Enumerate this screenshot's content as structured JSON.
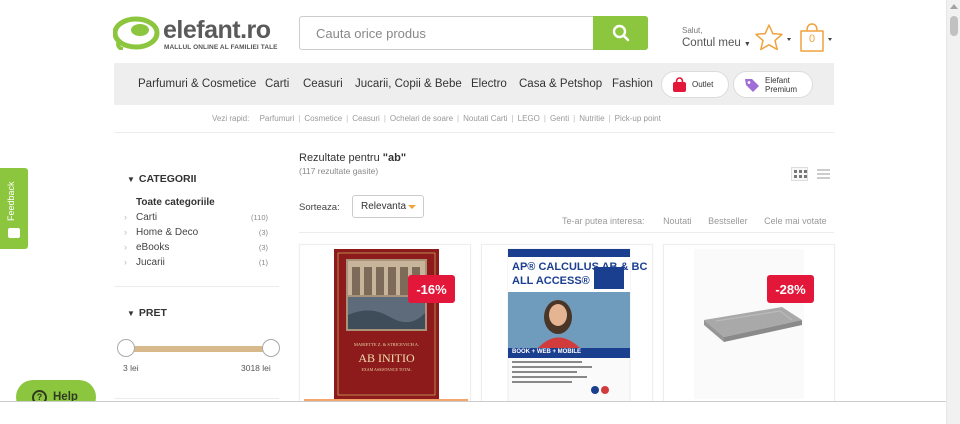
{
  "header": {
    "logo_text": "elefant.ro",
    "logo_tagline": "MALLUL ONLINE AL FAMILIEI TALE",
    "search_placeholder": "Cauta orice produs",
    "greeting": "Salut,",
    "account_label": "Contul meu",
    "cart_count": "0"
  },
  "nav": {
    "items": [
      "Parfumuri & Cosmetice",
      "Carti",
      "Ceasuri",
      "Jucarii, Copii & Bebe",
      "Electro",
      "Casa & Petshop",
      "Fashion"
    ],
    "outlet_label": "Outlet",
    "premium_label_1": "Elefant",
    "premium_label_2": "Premium"
  },
  "quick_links": {
    "label": "Vezi rapid:",
    "items": [
      "Parfumuri",
      "Cosmetice",
      "Ceasuri",
      "Ochelari de soare",
      "Noutati Carti",
      "LEGO",
      "Genti",
      "Nutritie",
      "Pick-up point"
    ]
  },
  "sidebar": {
    "categories_title": "CATEGORII",
    "all_categories": "Toate categoriile",
    "categories": [
      {
        "name": "Carti",
        "count": "(110)"
      },
      {
        "name": "Home & Deco",
        "count": "(3)"
      },
      {
        "name": "eBooks",
        "count": "(3)"
      },
      {
        "name": "Jucarii",
        "count": "(1)"
      }
    ],
    "price_title": "PRET",
    "price_min": "3 lei",
    "price_max": "3018 lei"
  },
  "feedback_label": "Feedback",
  "help_label": "Help",
  "results": {
    "title_prefix": "Rezultate pentru",
    "query": "\"ab\"",
    "count_text": "(117 rezultate gasite)",
    "sort_label": "Sorteaza:",
    "sort_value": "Relevanta",
    "interest_label": "Te-ar putea interesa:",
    "interest_options": [
      "Noutati",
      "Bestseller",
      "Cele mai votate"
    ]
  },
  "products": [
    {
      "discount": "-16%",
      "book_line1": "MARIETTE Z. & STRICEVICH A.",
      "book_title": "AB INITIO",
      "book_line3": "EXAM ASSISTANCE TOTAL"
    },
    {
      "discount": "",
      "book_title": "AP® CALCULUS AB & BC",
      "book_subtitle": "ALL ACCESS®",
      "book_footer": "BOOK + WEB + MOBILE"
    },
    {
      "discount": "-28%"
    }
  ],
  "colors": {
    "brand_green": "#8cc63f",
    "accent_orange": "#f0a23b",
    "discount_red": "#e3173a",
    "outlet_red": "#e3173a",
    "premium_purple": "#a06cd5"
  }
}
